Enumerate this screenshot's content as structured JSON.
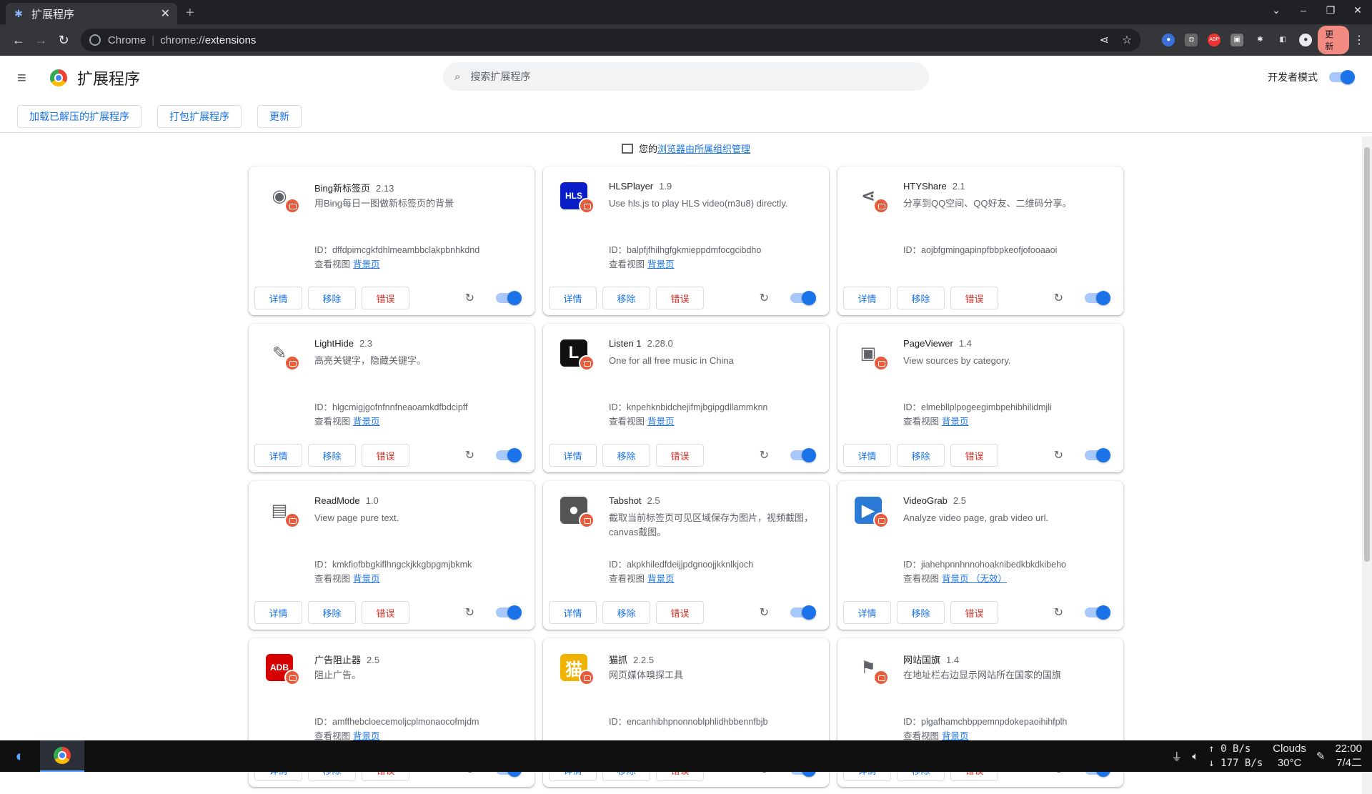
{
  "browser": {
    "tab_title": "扩展程序",
    "tab_close": "✕",
    "new_tab": "+",
    "omnibox_site": "Chrome",
    "omnibox_sep": "|",
    "omnibox_scheme": "chrome://",
    "omnibox_path": "extensions",
    "update_label": "更新"
  },
  "header": {
    "title": "扩展程序",
    "search_placeholder": "搜索扩展程序",
    "dev_mode_label": "开发者模式"
  },
  "dev_toolbar": {
    "load_unpacked": "加载已解压的扩展程序",
    "pack": "打包扩展程序",
    "update": "更新"
  },
  "managed": {
    "prefix": "您的",
    "link": "浏览器由所属组织管理"
  },
  "labels": {
    "id_prefix": "ID：",
    "views_prefix": "查看视图",
    "details": "详情",
    "remove": "移除",
    "errors": "错误"
  },
  "extensions": [
    {
      "name": "Bing新标签页",
      "version": "2.13",
      "description": "用Bing每日一图做新标签页的背景",
      "id": "dffdpimcgkfdhlmeambbclakpbnhkdnd",
      "view_link": "背景页",
      "icon_color": "#ffffff",
      "icon_text": "◉"
    },
    {
      "name": "HLSPlayer",
      "version": "1.9",
      "description": "Use hls.js to play HLS video(m3u8) directly.",
      "id": "balpfjfhilhgfgkmieppdmfocgcibdho",
      "view_link": "背景页",
      "icon_color": "#0a1ec8",
      "icon_text": "HLS"
    },
    {
      "name": "HTYShare",
      "version": "2.1",
      "description": "分享到QQ空间、QQ好友、二维码分享。",
      "id": "aojbfgmingapinpfbbpkeofjofooaaoi",
      "view_link": "",
      "icon_color": "#ffffff",
      "icon_text": "⋖"
    },
    {
      "name": "LightHide",
      "version": "2.3",
      "description": "高亮关键字，隐藏关键字。",
      "id": "hlgcmigjgofnfnnfneaoamkdfbdcipff",
      "view_link": "背景页",
      "icon_color": "#ffffff",
      "icon_text": "✎"
    },
    {
      "name": "Listen 1",
      "version": "2.28.0",
      "description": "One for all free music in China",
      "id": "knpehknbidchejifmjbgipgdllammknn",
      "view_link": "背景页",
      "icon_color": "#111111",
      "icon_text": "L"
    },
    {
      "name": "PageViewer",
      "version": "1.4",
      "description": "View sources by category.",
      "id": "elmebllplpogeegimbpehibhilidmjli",
      "view_link": "背景页",
      "icon_color": "#ffffff",
      "icon_text": "▣"
    },
    {
      "name": "ReadMode",
      "version": "1.0",
      "description": "View page pure text.",
      "id": "kmkfiofbbgkiflhngckjkkgbpgmjbkmk",
      "view_link": "背景页",
      "icon_color": "#ffffff",
      "icon_text": "▤"
    },
    {
      "name": "Tabshot",
      "version": "2.5",
      "description": "截取当前标签页可见区域保存为图片，视频截图，canvas截图。",
      "id": "akpkhiledfdeijjpdgnoojjkknlkjoch",
      "view_link": "背景页",
      "icon_color": "#555555",
      "icon_text": "●"
    },
    {
      "name": "VideoGrab",
      "version": "2.5",
      "description": "Analyze video page, grab video url.",
      "id": "jiahehpnnhnnohoaknibedkbkdkibeho",
      "view_link": "背景页 （无效）",
      "icon_color": "#2b7bd6",
      "icon_text": "▶"
    },
    {
      "name": "广告阻止器",
      "version": "2.5",
      "description": "阻止广告。",
      "id": "amffhebcloecemoljcplmonaocofmjdm",
      "view_link": "背景页",
      "icon_color": "#d60000",
      "icon_text": "ADB"
    },
    {
      "name": "猫抓",
      "version": "2.2.5",
      "description": "网页媒体嗅探工具",
      "id": "encanhibhpnonnoblphlidhbbennfbjb",
      "view_link": "",
      "icon_color": "#f0b400",
      "icon_text": "猫"
    },
    {
      "name": "网站国旗",
      "version": "1.4",
      "description": "在地址栏右边显示网站所在国家的国旗",
      "id": "plgafhamchbppemnpdokepaoihihfplh",
      "view_link": "背景页",
      "icon_color": "#ffffff",
      "icon_text": "⚑"
    }
  ],
  "taskbar": {
    "net_up": "0 B/s",
    "net_down": "177 B/s",
    "weather": "Clouds",
    "temperature": "30°C",
    "time": "22:00",
    "date": "7/4二"
  }
}
